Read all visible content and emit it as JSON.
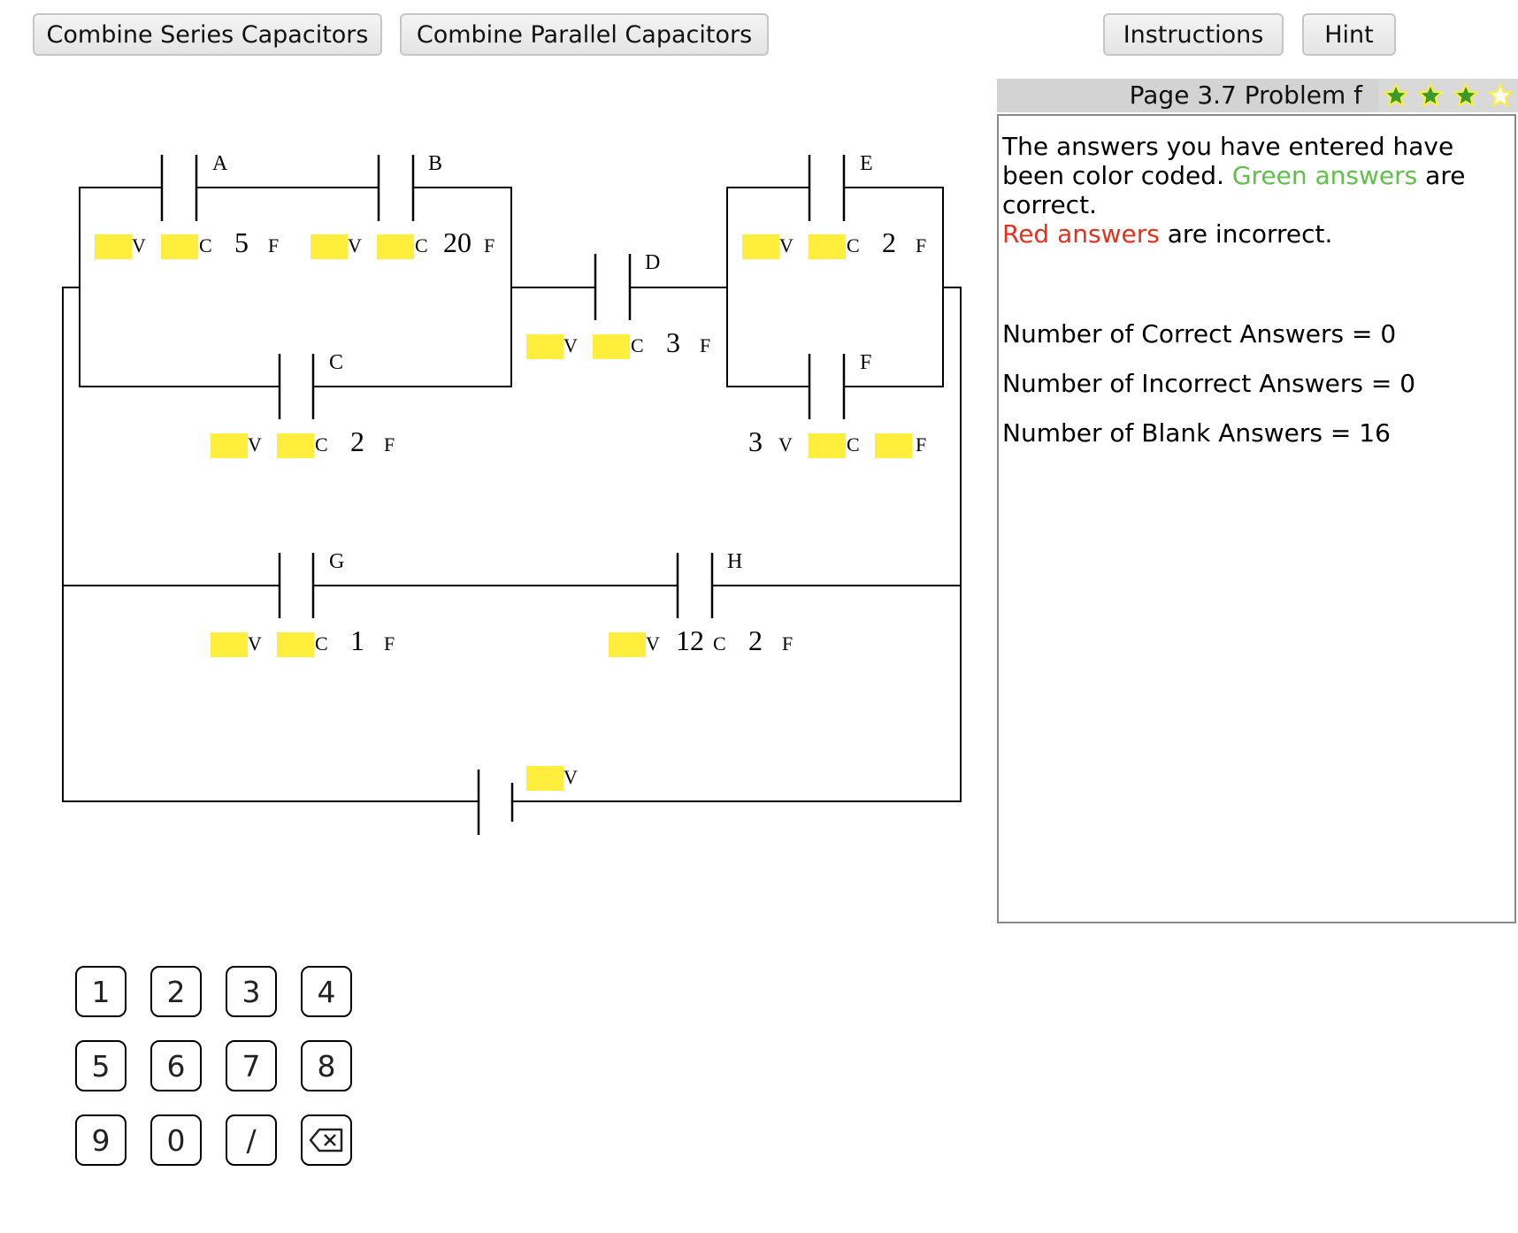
{
  "toolbar": {
    "combine_series": "Combine Series Capacitors",
    "combine_parallel": "Combine Parallel Capacitors",
    "instructions": "Instructions",
    "hint": "Hint"
  },
  "panel": {
    "title": "Page 3.7 Problem f",
    "stars": {
      "total": 4,
      "filled": 3
    },
    "message": {
      "part1": "The answers you have entered have been color coded.",
      "green_text": "Green answers",
      "part2": "are correct.",
      "red_text": "Red answers",
      "part3": "are incorrect."
    },
    "correct": "Number of Correct Answers = 0",
    "incorrect": "Number of Incorrect Answers = 0",
    "blank": "Number of Blank Answers = 16"
  },
  "circuit": {
    "capacitors": {
      "A": {
        "name": "A",
        "v": "",
        "c": "",
        "f": "5",
        "v_unit": "V",
        "c_unit": "C",
        "f_unit": "F"
      },
      "B": {
        "name": "B",
        "v": "",
        "c": "",
        "f": "20",
        "v_unit": "V",
        "c_unit": "C",
        "f_unit": "F"
      },
      "C": {
        "name": "C",
        "v": "",
        "c": "",
        "f": "2",
        "v_unit": "V",
        "c_unit": "C",
        "f_unit": "F"
      },
      "D": {
        "name": "D",
        "v": "",
        "c": "",
        "f": "3",
        "v_unit": "V",
        "c_unit": "C",
        "f_unit": "F"
      },
      "E": {
        "name": "E",
        "v": "",
        "c": "",
        "f": "2",
        "v_unit": "V",
        "c_unit": "C",
        "f_unit": "F"
      },
      "F": {
        "name": "F",
        "v": "3",
        "c": "",
        "f": "",
        "v_unit": "V",
        "c_unit": "C",
        "f_unit": "F"
      },
      "G": {
        "name": "G",
        "v": "",
        "c": "",
        "f": "1",
        "v_unit": "V",
        "c_unit": "C",
        "f_unit": "F"
      },
      "H": {
        "name": "H",
        "v": "",
        "c": "12",
        "f": "2",
        "v_unit": "V",
        "c_unit": "C",
        "f_unit": "F"
      }
    },
    "battery": {
      "v": "",
      "v_unit": "V"
    }
  },
  "keypad": {
    "keys": [
      "1",
      "2",
      "3",
      "4",
      "5",
      "6",
      "7",
      "8",
      "9",
      "0",
      "/",
      "⌫"
    ]
  },
  "colors": {
    "input_highlight": "#ffee3c",
    "correct": "#5fc14a",
    "incorrect": "#e0321e",
    "star": "#3a9a2a"
  }
}
